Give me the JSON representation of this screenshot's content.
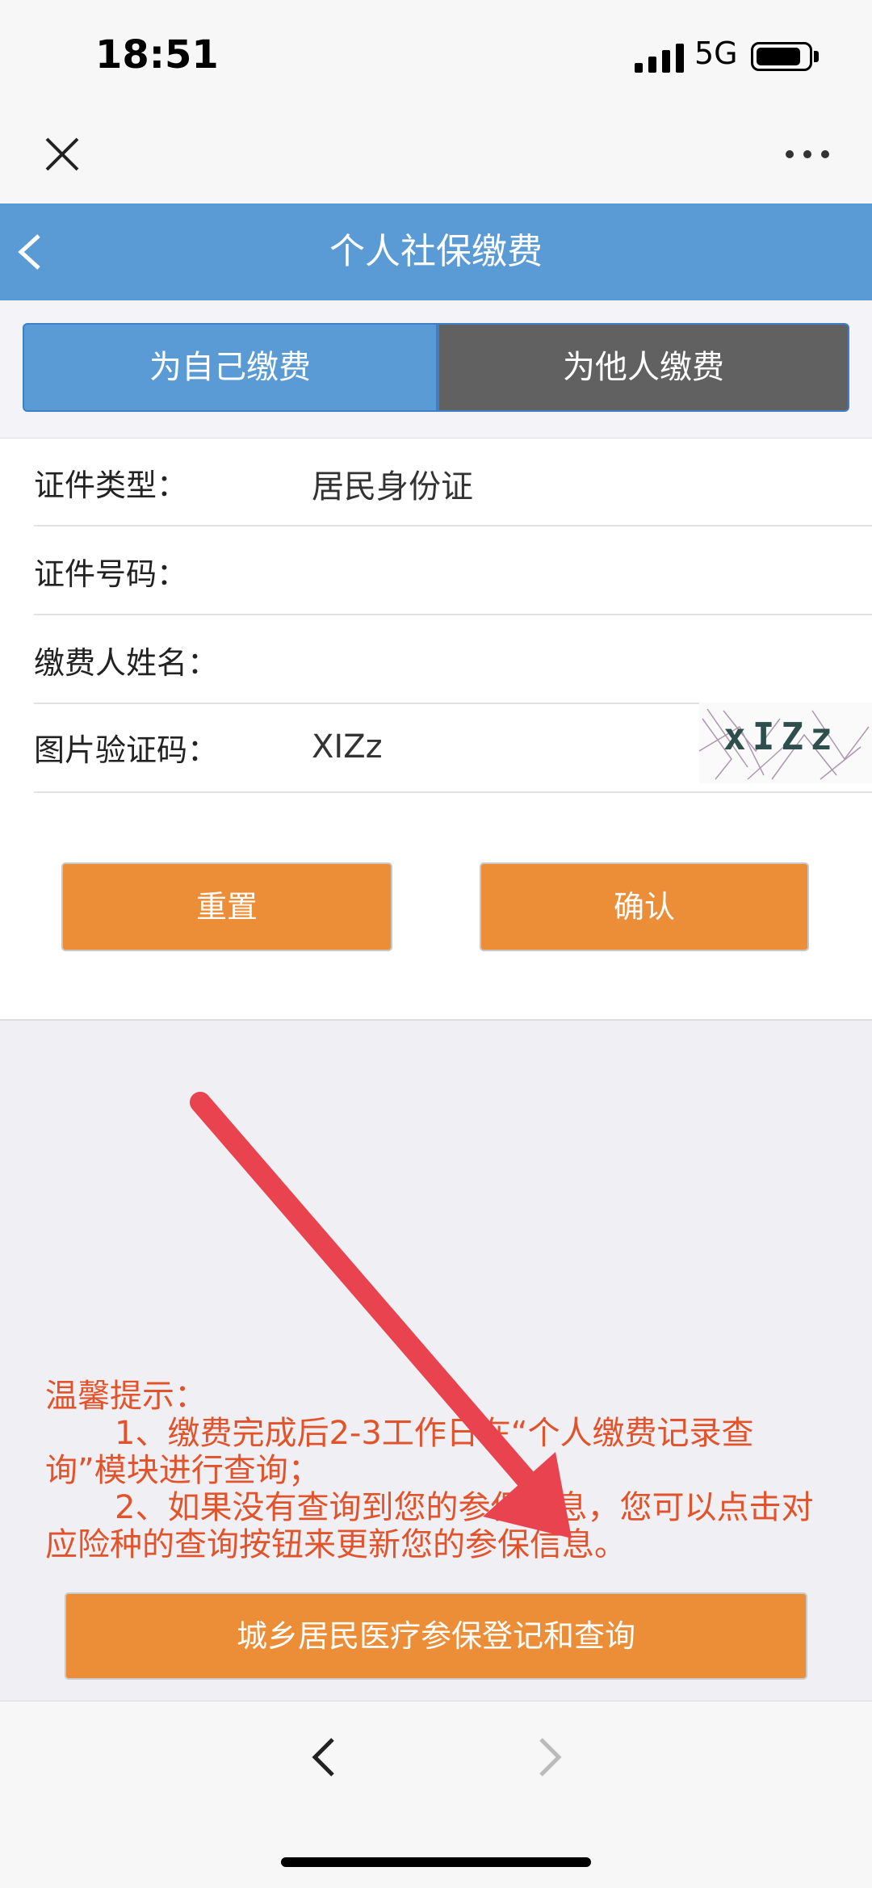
{
  "status_bar": {
    "time": "18:51",
    "network": "5G"
  },
  "header": {
    "title": "个人社保缴费"
  },
  "tabs": [
    {
      "label": "为自己缴费",
      "active": true
    },
    {
      "label": "为他人缴费",
      "active": false
    }
  ],
  "form": {
    "id_type": {
      "label": "证件类型：",
      "value": "居民身份证"
    },
    "id_number": {
      "label": "证件号码：",
      "value": ""
    },
    "payer_name": {
      "label": "缴费人姓名：",
      "value": ""
    },
    "captcha": {
      "label": "图片验证码：",
      "value": "XIZz",
      "image_text": "xIZz"
    }
  },
  "buttons": {
    "reset": "重置",
    "confirm": "确认",
    "query": "城乡居民医疗参保登记和查询"
  },
  "tips": {
    "title": "温馨提示：",
    "item1": "1、缴费完成后2-3工作日在“个人缴费记录查询”模块进行查询；",
    "item2": "2、如果没有查询到您的参保信息，您可以点击对应险种的查询按钮来更新您的参保信息。"
  },
  "colors": {
    "header": "#5b9bd5",
    "tab_inactive": "#616161",
    "button": "#ec8e38",
    "tip_text": "#e3532b",
    "arrow": "#e8434f"
  }
}
